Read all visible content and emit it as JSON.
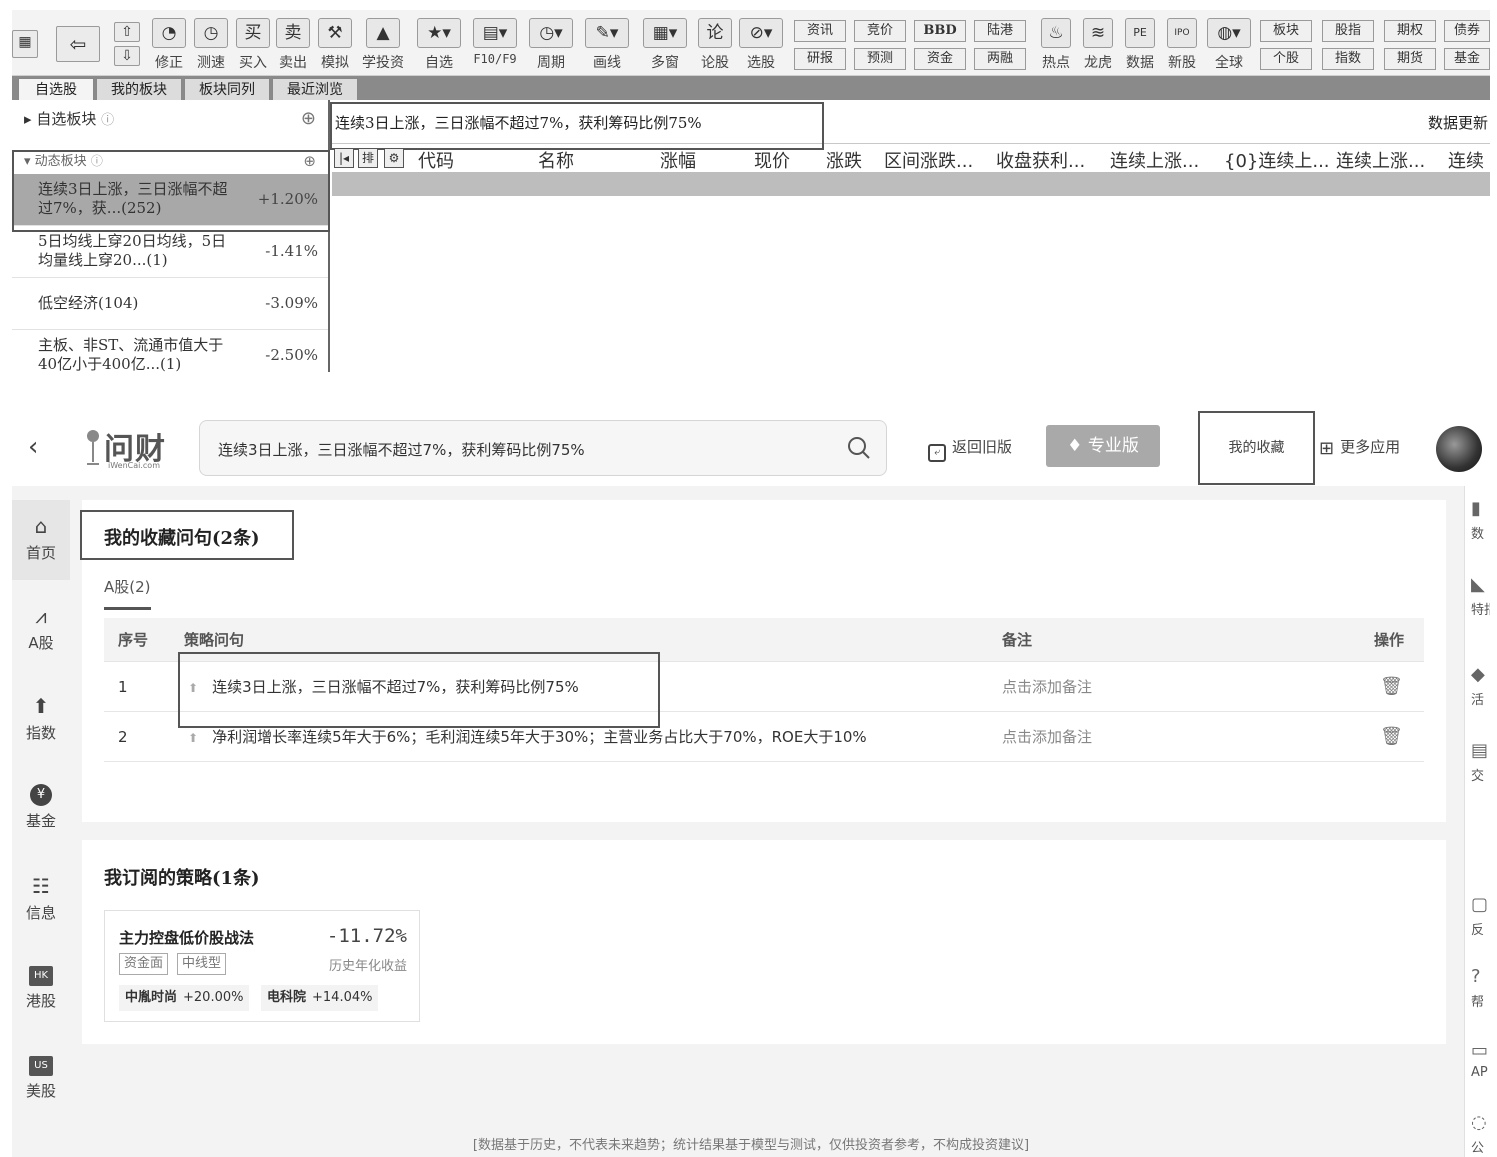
{
  "top_app": {
    "toolbar": {
      "buttons": [
        {
          "icon": "⇧",
          "label": "修正"
        },
        {
          "icon": "◔",
          "label": "测速"
        },
        {
          "icon": "买",
          "label": "买入"
        },
        {
          "icon": "卖",
          "label": "卖出"
        },
        {
          "icon": "⚒",
          "label": "模拟"
        },
        {
          "icon": "🎓",
          "label": "学投资"
        },
        {
          "icon": "★",
          "label": "自选"
        },
        {
          "icon": "▤",
          "label": "F10/F9"
        },
        {
          "icon": "◷",
          "label": "周期"
        },
        {
          "icon": "✎",
          "label": "画线"
        },
        {
          "icon": "▦",
          "label": "多窗"
        },
        {
          "icon": "论",
          "label": "论股"
        },
        {
          "icon": "⊘",
          "label": "选股"
        }
      ],
      "pairs": [
        {
          "top": "资讯",
          "bottom": "研报"
        },
        {
          "top": "竞价",
          "bottom": "预测"
        },
        {
          "top": "BBD",
          "bottom": "资金"
        },
        {
          "top": "陆港",
          "bottom": "两融"
        }
      ],
      "icon_buttons": [
        {
          "icon": "♨",
          "label": "热点"
        },
        {
          "icon": "≋",
          "label": "龙虎"
        },
        {
          "icon": "PE",
          "label": "数据"
        },
        {
          "icon": "IPO",
          "label": "新股"
        },
        {
          "icon": "◍",
          "label": "全球"
        }
      ],
      "pairs2": [
        {
          "top": "板块",
          "bottom": "个股"
        },
        {
          "top": "股指",
          "bottom": "指数"
        },
        {
          "top": "期权",
          "bottom": "期货"
        },
        {
          "top": "债券",
          "bottom": "基金"
        }
      ]
    },
    "tabs": [
      "自选股",
      "我的板块",
      "板块同列",
      "最近浏览"
    ],
    "left_panel": {
      "header1": "自选板块",
      "header2": "动态板块",
      "items": [
        {
          "name": "连续3日上涨，三日涨幅不超过7%，获...(252)",
          "change": "+1.20%"
        },
        {
          "name": "5日均线上穿20日均线，5日均量线上穿20...(1)",
          "change": "-1.41%"
        },
        {
          "name": "低空经济(104)",
          "change": "-3.09%"
        },
        {
          "name": "主板、非ST、流通市值大于40亿小于400亿...(1)",
          "change": "-2.50%"
        }
      ]
    },
    "query_text": "连续3日上涨，三日涨幅不超过7%，获利筹码比例75%",
    "data_update": "数据更新",
    "grid_columns": [
      "代码",
      "名称",
      "涨幅",
      "现价",
      "涨跌",
      "区间涨跌...",
      "收盘获利...",
      "连续上涨...",
      "{0}连续上...",
      "连续上涨...",
      "连续"
    ]
  },
  "web_app": {
    "logo": "问财",
    "logo_sub": "iWenCai.com",
    "search_text": "连续3日上涨，三日涨幅不超过7%，获利筹码比例75%",
    "old_version": "返回旧版",
    "pro_version": "专业版",
    "my_favorites": "我的收藏",
    "more_apps": "更多应用",
    "side_nav": [
      {
        "icon": "home-icon",
        "glyph": "⌂",
        "label": "首页"
      },
      {
        "icon": "chart-icon",
        "glyph": "⩘",
        "label": "A股"
      },
      {
        "icon": "index-icon",
        "glyph": "⬆",
        "label": "指数"
      },
      {
        "icon": "yuan-icon",
        "glyph": "¥",
        "label": "基金"
      },
      {
        "icon": "info-icon",
        "glyph": "☷",
        "label": "信息"
      },
      {
        "icon": "hk-icon",
        "glyph": "HK",
        "label": "港股"
      },
      {
        "icon": "us-icon",
        "glyph": "US",
        "label": "美股"
      }
    ],
    "favorites": {
      "title": "我的收藏问句(2条)",
      "tab": "A股(2)",
      "columns": {
        "index": "序号",
        "query": "策略问句",
        "remark": "备注",
        "action": "操作"
      },
      "rows": [
        {
          "index": "1",
          "query": "连续3日上涨，三日涨幅不超过7%，获利筹码比例75%",
          "remark": "点击添加备注"
        },
        {
          "index": "2",
          "query": "净利润增长率连续5年大于6%；毛利润连续5年大于30%；主营业务占比大于70%，ROE大于10%",
          "remark": "点击添加备注"
        }
      ]
    },
    "subscriptions": {
      "title": "我订阅的策略(1条)",
      "strategy": {
        "name": "主力控盘低价股战法",
        "return": "-11.72%",
        "return_label": "历史年化收益",
        "tags": [
          "资金面",
          "中线型"
        ],
        "stocks": [
          {
            "name": "中胤时尚",
            "change": "+20.00%"
          },
          {
            "name": "电科院",
            "change": "+14.04%"
          }
        ]
      }
    },
    "right_rail": [
      "数",
      "特指",
      "活",
      "交",
      "反",
      "帮",
      "AP",
      "公"
    ],
    "disclaimer": "[数据基于历史，不代表未来趋势；统计结果基于模型与测试，仅供投资者参考，不构成投资建议]"
  }
}
